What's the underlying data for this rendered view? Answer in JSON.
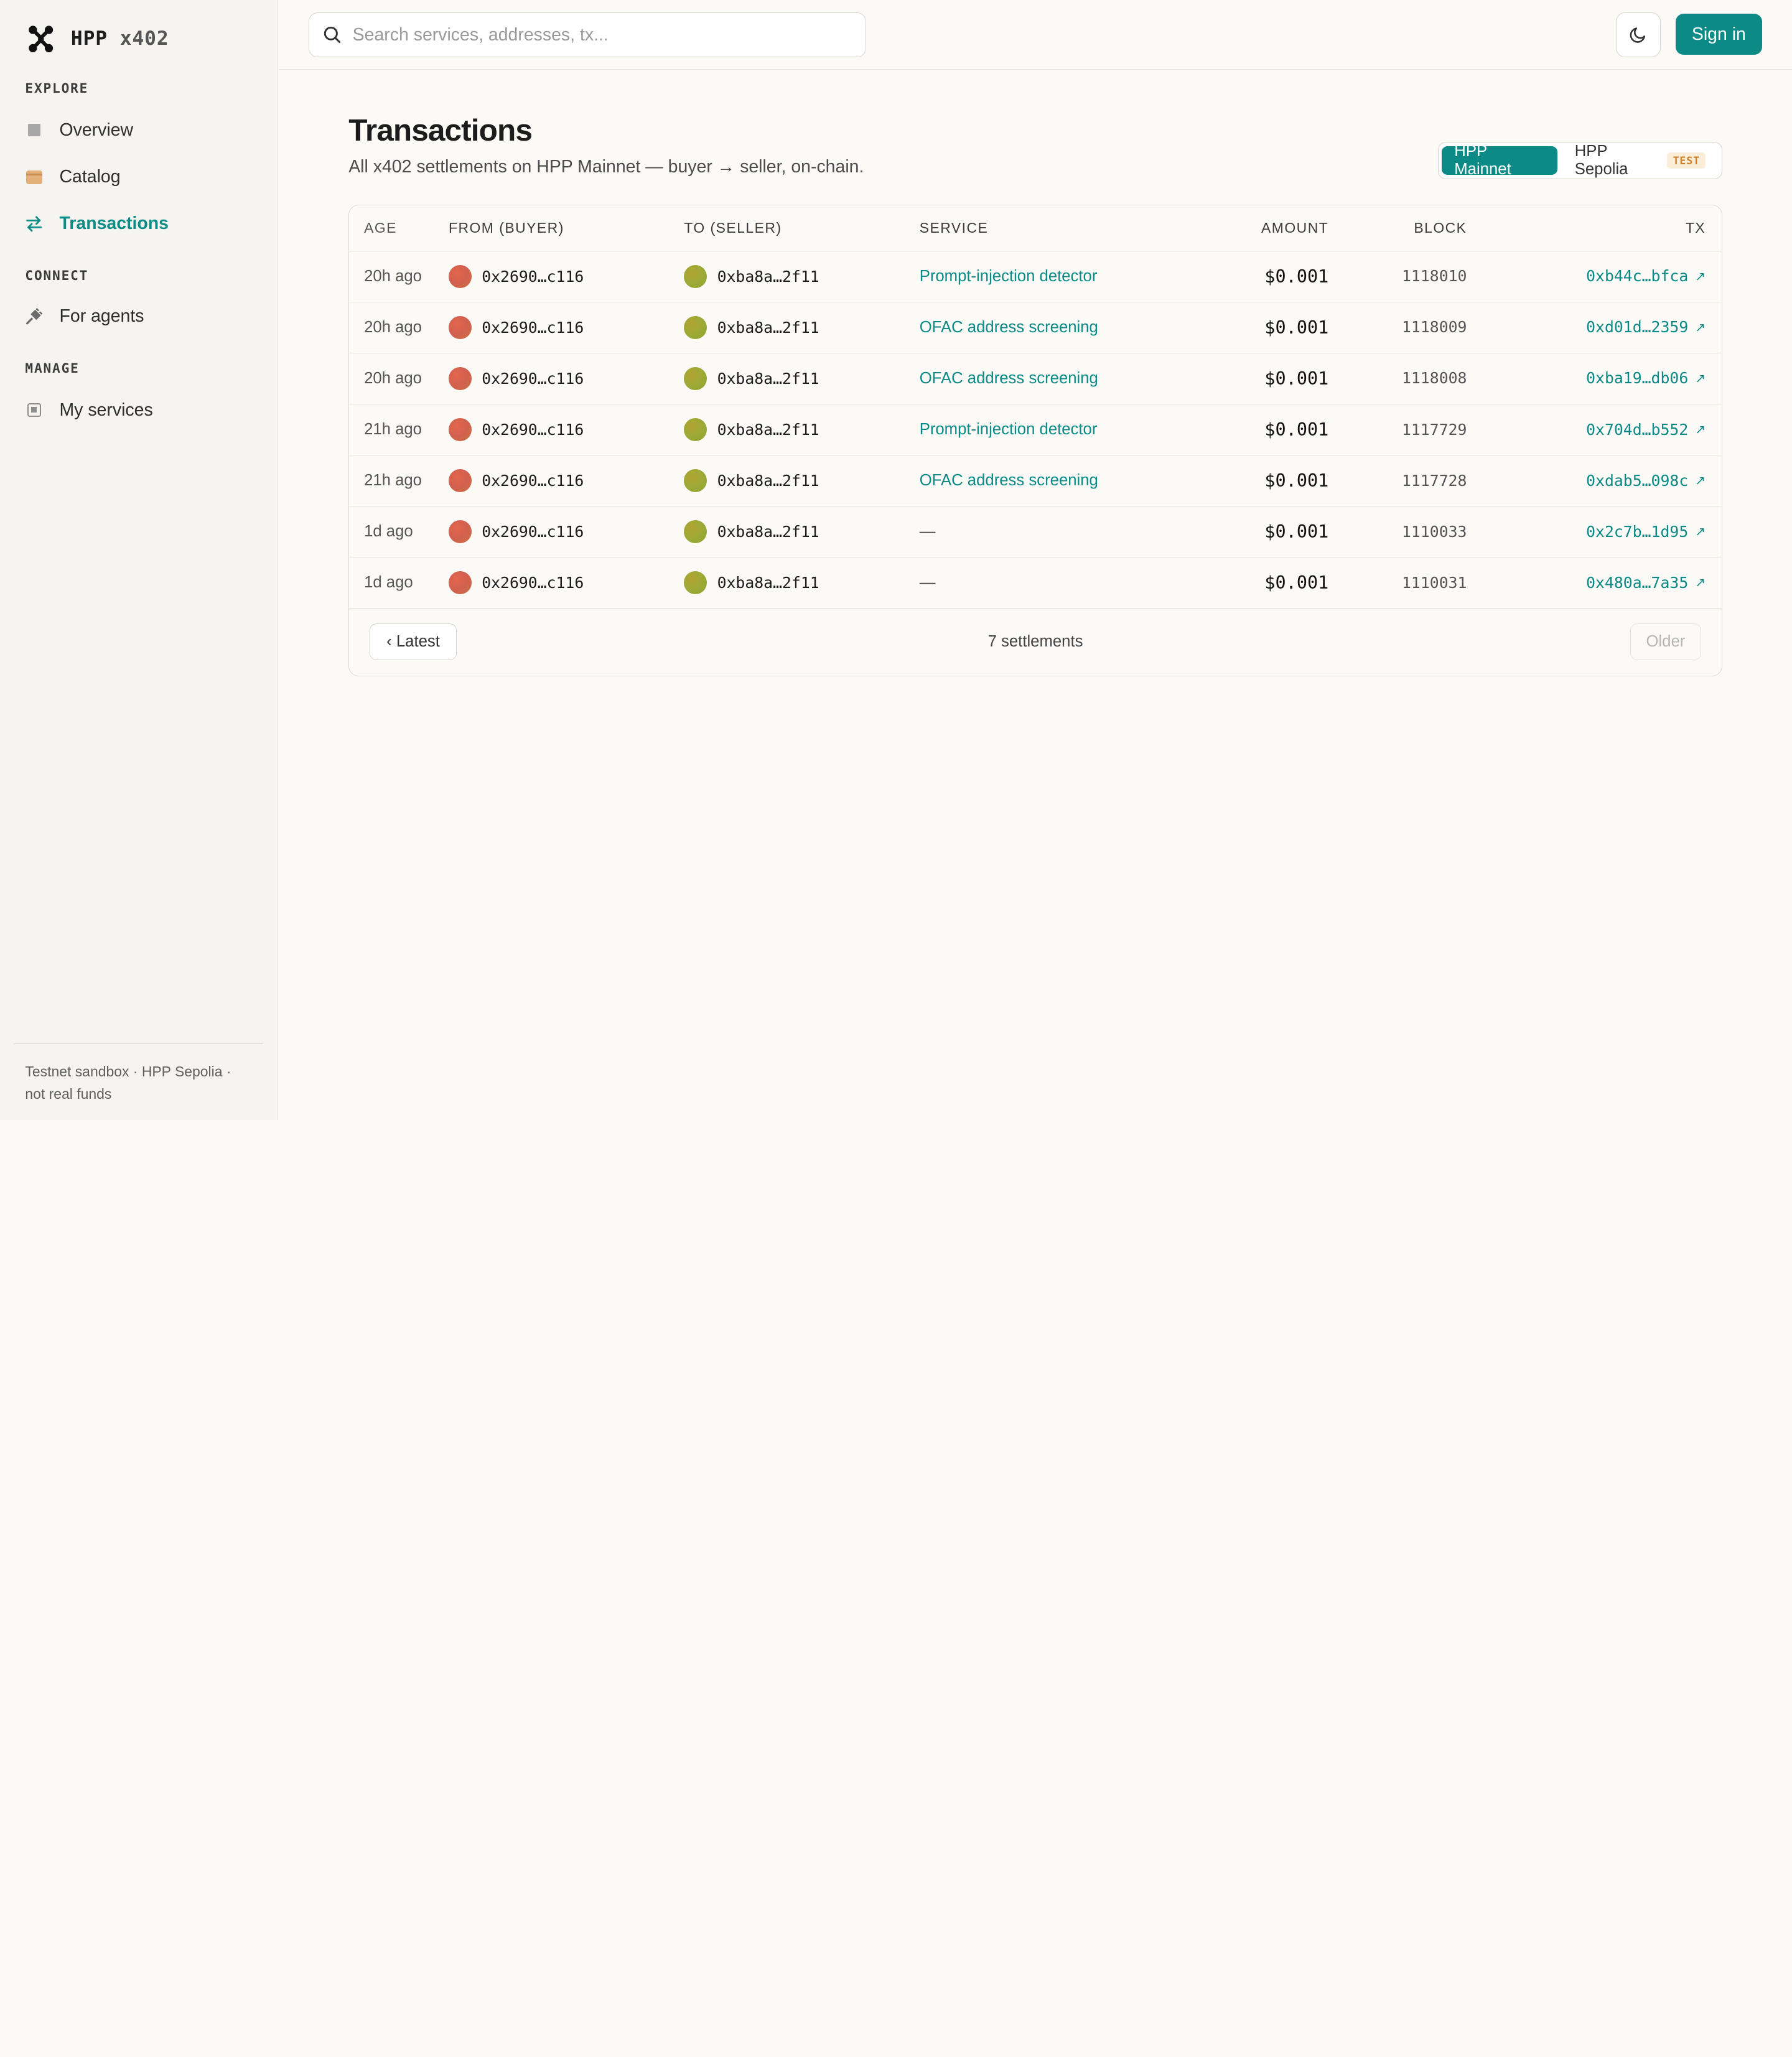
{
  "brand": {
    "name": "HPP",
    "suffix": "x402"
  },
  "sidebar": {
    "sections": [
      {
        "title": "EXPLORE"
      },
      {
        "title": "CONNECT"
      },
      {
        "title": "MANAGE"
      }
    ],
    "items": [
      {
        "label": "Overview",
        "icon": "square-icon"
      },
      {
        "label": "Catalog",
        "icon": "box-icon"
      },
      {
        "label": "Transactions",
        "icon": "arrows-exchange-icon",
        "active": true
      },
      {
        "label": "For agents",
        "icon": "plug-icon"
      },
      {
        "label": "My services",
        "icon": "chip-icon"
      }
    ],
    "footer": "Testnet sandbox · HPP Sepolia · not real funds"
  },
  "header": {
    "search_placeholder": "Search services, addresses, tx...",
    "signin_label": "Sign in"
  },
  "page": {
    "title": "Transactions",
    "subtitle": "All x402 settlements on HPP Mainnet — buyer → seller, on-chain.",
    "networks": [
      {
        "label": "HPP Mainnet",
        "active": true
      },
      {
        "label": "HPP Sepolia",
        "badge": "TEST"
      }
    ]
  },
  "table": {
    "columns": [
      "AGE",
      "FROM (BUYER)",
      "TO (SELLER)",
      "SERVICE",
      "AMOUNT",
      "BLOCK",
      "TX"
    ],
    "rows": [
      {
        "age": "20h ago",
        "from": "0x2690…c116",
        "to": "0xba8a…2f11",
        "service": "Prompt-injection detector",
        "amount": "$0.001",
        "block": "1118010",
        "tx": "0xb44c…bfca"
      },
      {
        "age": "20h ago",
        "from": "0x2690…c116",
        "to": "0xba8a…2f11",
        "service": "OFAC address screening",
        "amount": "$0.001",
        "block": "1118009",
        "tx": "0xd01d…2359"
      },
      {
        "age": "20h ago",
        "from": "0x2690…c116",
        "to": "0xba8a…2f11",
        "service": "OFAC address screening",
        "amount": "$0.001",
        "block": "1118008",
        "tx": "0xba19…db06"
      },
      {
        "age": "21h ago",
        "from": "0x2690…c116",
        "to": "0xba8a…2f11",
        "service": "Prompt-injection detector",
        "amount": "$0.001",
        "block": "1117729",
        "tx": "0x704d…b552"
      },
      {
        "age": "21h ago",
        "from": "0x2690…c116",
        "to": "0xba8a…2f11",
        "service": "OFAC address screening",
        "amount": "$0.001",
        "block": "1117728",
        "tx": "0xdab5…098c"
      },
      {
        "age": "1d ago",
        "from": "0x2690…c116",
        "to": "0xba8a…2f11",
        "service": "—",
        "amount": "$0.001",
        "block": "1110033",
        "tx": "0x2c7b…1d95"
      },
      {
        "age": "1d ago",
        "from": "0x2690…c116",
        "to": "0xba8a…2f11",
        "service": "—",
        "amount": "$0.001",
        "block": "1110031",
        "tx": "0x480a…7a35"
      }
    ],
    "footer": {
      "prev_label": "‹ Latest",
      "count_label": "7 settlements",
      "next_label": "Older"
    }
  },
  "colors": {
    "accent": "#0b8a86",
    "background": "#fbfaf7",
    "sidebar": "#f5f4f0"
  }
}
